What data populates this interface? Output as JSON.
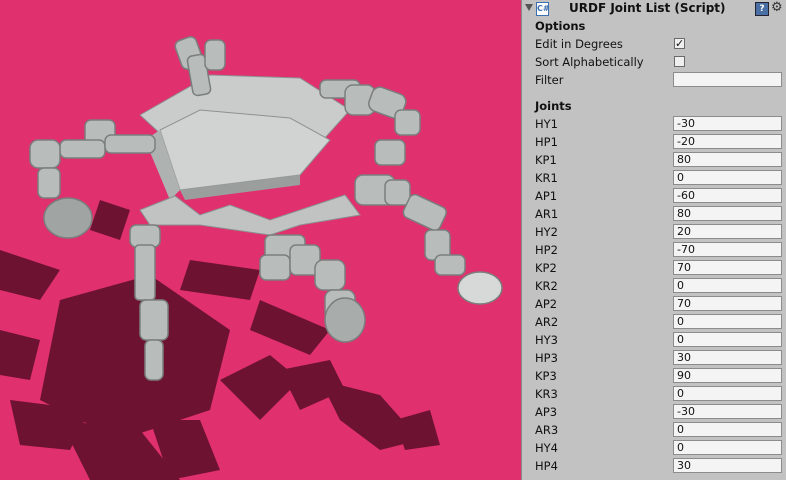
{
  "inspector": {
    "component_title": "URDF Joint List (Script)",
    "options_label": "Options",
    "edit_in_degrees_label": "Edit in Degrees",
    "edit_in_degrees_checked": true,
    "sort_alphabetically_label": "Sort Alphabetically",
    "sort_alphabetically_checked": false,
    "filter_label": "Filter",
    "filter_value": "",
    "joints_label": "Joints",
    "joints": [
      {
        "name": "HY1",
        "value": "-30"
      },
      {
        "name": "HP1",
        "value": "-20"
      },
      {
        "name": "KP1",
        "value": "80"
      },
      {
        "name": "KR1",
        "value": "0"
      },
      {
        "name": "AP1",
        "value": "-60"
      },
      {
        "name": "AR1",
        "value": "80"
      },
      {
        "name": "HY2",
        "value": "20"
      },
      {
        "name": "HP2",
        "value": "-70"
      },
      {
        "name": "KP2",
        "value": "70"
      },
      {
        "name": "KR2",
        "value": "0"
      },
      {
        "name": "AP2",
        "value": "70"
      },
      {
        "name": "AR2",
        "value": "0"
      },
      {
        "name": "HY3",
        "value": "0"
      },
      {
        "name": "HP3",
        "value": "30"
      },
      {
        "name": "KP3",
        "value": "90"
      },
      {
        "name": "KR3",
        "value": "0"
      },
      {
        "name": "AP3",
        "value": "-30"
      },
      {
        "name": "AR3",
        "value": "0"
      },
      {
        "name": "HY4",
        "value": "0"
      },
      {
        "name": "HP4",
        "value": "30"
      }
    ]
  },
  "viewport": {
    "background_color": "#e0306e",
    "shadow_color": "#6e1232",
    "robot_color": "#c9cccb"
  }
}
